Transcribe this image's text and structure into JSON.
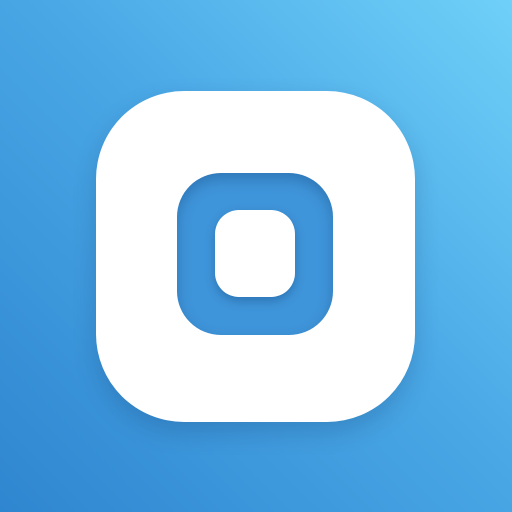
{
  "icon": {
    "name": "app-icon",
    "shapes": [
      "outer-rounded-square",
      "middle-rounded-square",
      "inner-rounded-square"
    ]
  },
  "colors": {
    "background_light": "#6fd0f8",
    "background_mid": "#4aa8e6",
    "background_dark": "#2f86d0",
    "outer_square": "#ffffff",
    "middle_square": "#3f95da",
    "inner_square": "#ffffff"
  }
}
